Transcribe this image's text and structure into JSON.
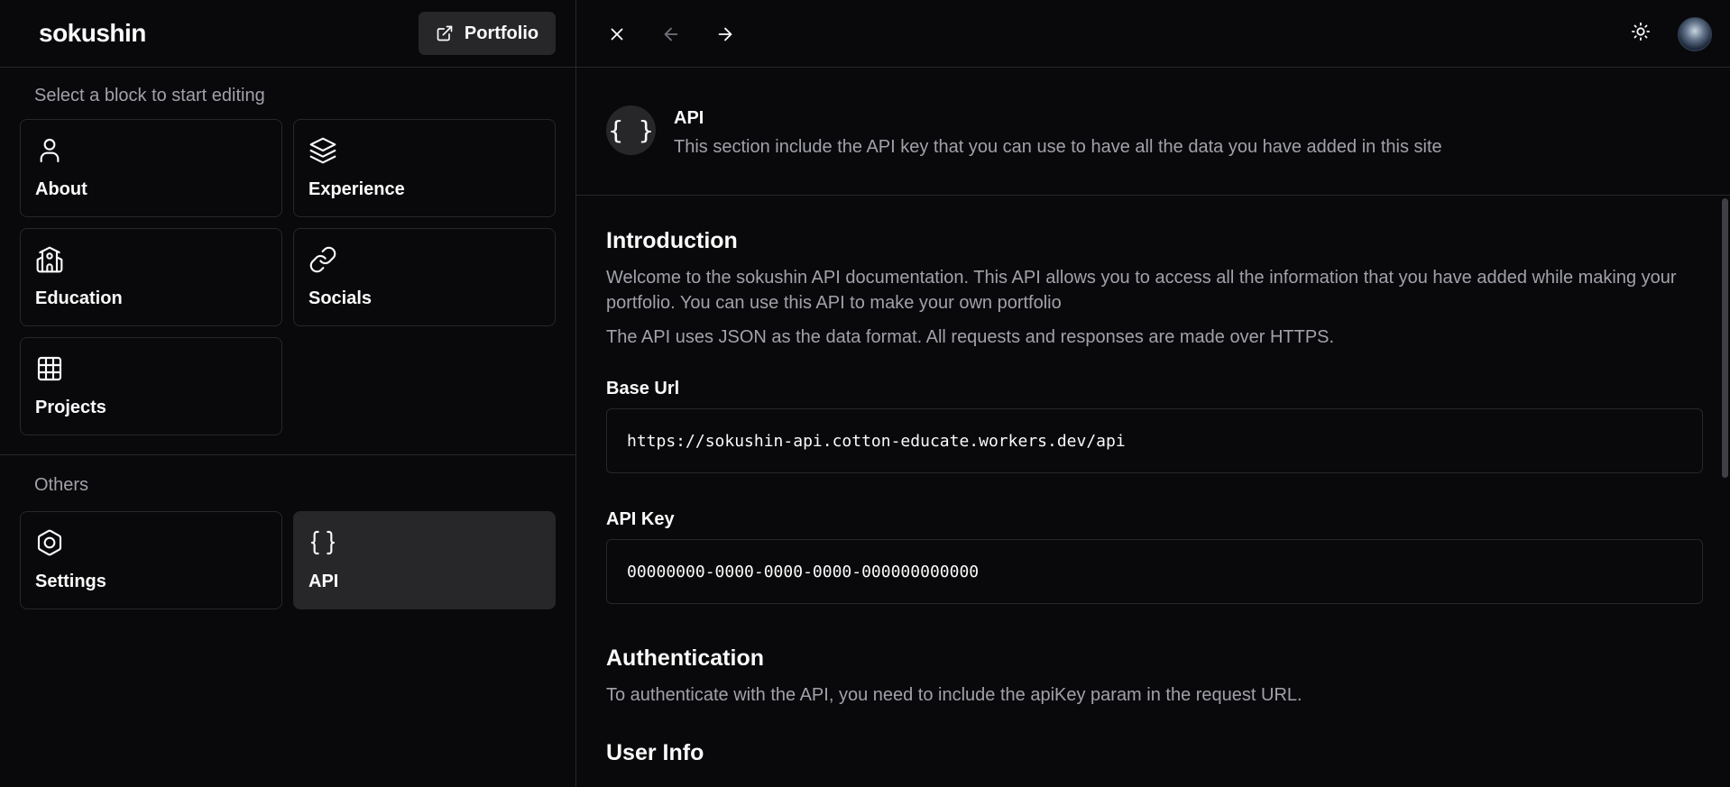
{
  "brand": "sokushin",
  "portfolio_label": "Portfolio",
  "blocks_label": "Select a block to start editing",
  "blocks": [
    {
      "label": "About",
      "icon": "user-icon"
    },
    {
      "label": "Experience",
      "icon": "layers-icon"
    },
    {
      "label": "Education",
      "icon": "school-icon"
    },
    {
      "label": "Socials",
      "icon": "link-icon"
    },
    {
      "label": "Projects",
      "icon": "grid-icon"
    }
  ],
  "others_label": "Others",
  "others": [
    {
      "label": "Settings",
      "icon": "hexagon-settings-icon"
    },
    {
      "label": "API",
      "icon": "braces-icon"
    }
  ],
  "api_header": {
    "badge": "{ }",
    "title": "API",
    "description": "This section include the API key that you can use to have all the data you have added in this site"
  },
  "intro": {
    "heading": "Introduction",
    "p1": "Welcome to the sokushin API documentation. This API allows you to access all the information that you have added while making your portfolio. You can use this API to make your own portfolio",
    "p2": "The API uses JSON as the data format. All requests and responses are made over HTTPS."
  },
  "base_url": {
    "label": "Base Url",
    "value": "https://sokushin-api.cotton-educate.workers.dev/api"
  },
  "api_key": {
    "label": "API Key",
    "value": "00000000-0000-0000-0000-000000000000"
  },
  "auth": {
    "heading": "Authentication",
    "text": "To authenticate with the API, you need to include the apiKey param in the request URL."
  },
  "user_info": {
    "heading": "User Info"
  }
}
